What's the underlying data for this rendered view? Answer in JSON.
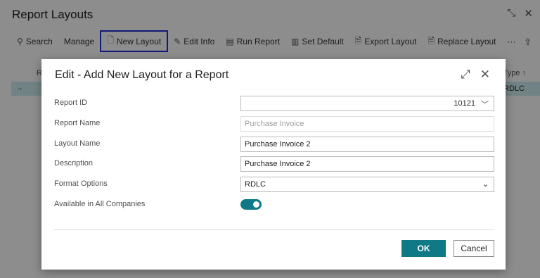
{
  "page": {
    "title": "Report Layouts",
    "window_controls": [
      "collapse-icon",
      "close-icon"
    ]
  },
  "toolbar": {
    "items": [
      {
        "label": "Search",
        "icon": "search-icon"
      },
      {
        "label": "Manage",
        "icon": ""
      },
      {
        "label": "New Layout",
        "icon": "new-document-icon",
        "highlighted": true
      },
      {
        "label": "Edit Info",
        "icon": "pencil-icon"
      },
      {
        "label": "Run Report",
        "icon": "report-icon"
      },
      {
        "label": "Set Default",
        "icon": "table-icon"
      },
      {
        "label": "Export Layout",
        "icon": "export-icon"
      },
      {
        "label": "Replace Layout",
        "icon": "replace-icon"
      },
      {
        "label": "···",
        "icon": "more-icon"
      }
    ],
    "share_icon": "share-icon",
    "highlight_color": "#1f2fd0"
  },
  "list": {
    "col_r": "R",
    "col_type": "Type ↑",
    "row_type": "RDLC",
    "row_arrow": "→",
    "selected_color": "#c7e7e8"
  },
  "dialog": {
    "title": "Edit - Add New Layout for a Report",
    "expand_icon": "expand-icon",
    "close_icon": "close-icon",
    "fields": {
      "report_id": {
        "label": "Report ID",
        "value": "10121"
      },
      "report_name": {
        "label": "Report Name",
        "placeholder": "Purchase Invoice"
      },
      "layout_name": {
        "label": "Layout Name",
        "value": "Purchase Invoice 2"
      },
      "description": {
        "label": "Description",
        "value": "Purchase Invoice 2"
      },
      "format_options": {
        "label": "Format Options",
        "value": "RDLC"
      },
      "available_all": {
        "label": "Available in All Companies",
        "value": true
      }
    },
    "ok_label": "OK",
    "cancel_label": "Cancel",
    "accent_color": "#0f7a86"
  }
}
